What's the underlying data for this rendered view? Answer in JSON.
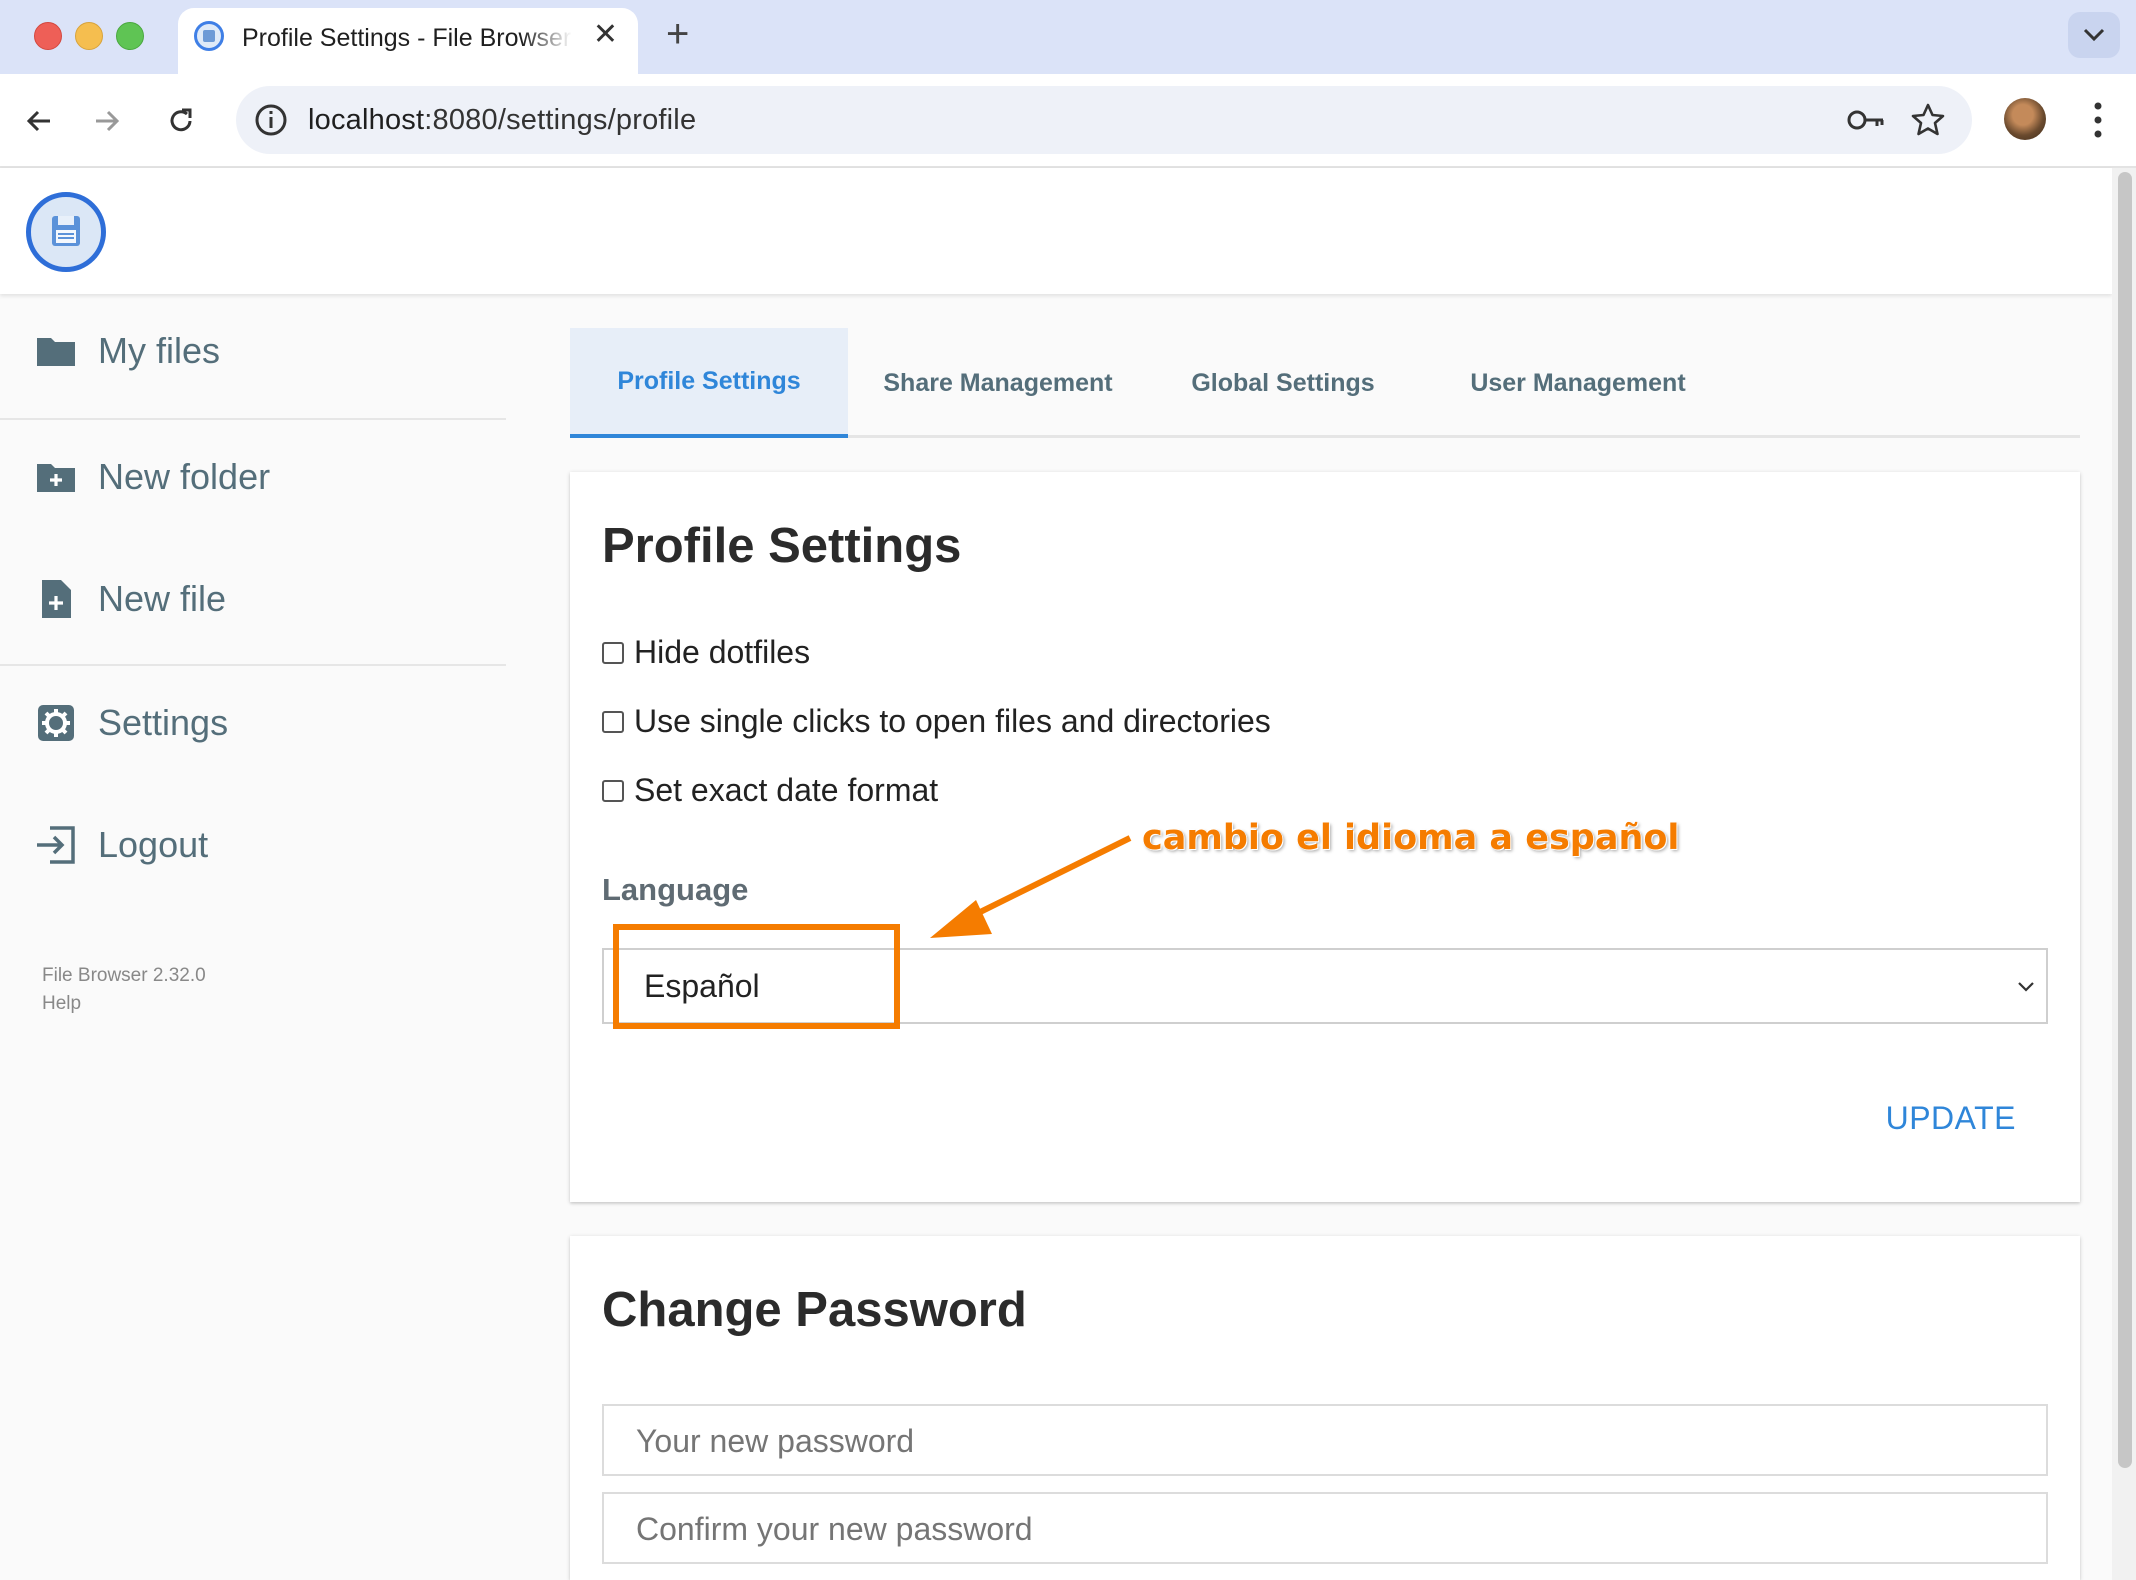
{
  "browser": {
    "tab_title": "Profile Settings - File Browser",
    "url_host": "localhost",
    "url_rest": ":8080/settings/profile"
  },
  "sidebar": {
    "items": [
      {
        "label": "My files",
        "icon": "folder-icon"
      },
      {
        "label": "New folder",
        "icon": "folder-plus-icon"
      },
      {
        "label": "New file",
        "icon": "file-plus-icon"
      },
      {
        "label": "Settings",
        "icon": "gear-icon"
      },
      {
        "label": "Logout",
        "icon": "logout-icon"
      }
    ],
    "version": "File Browser 2.32.0",
    "help": "Help"
  },
  "settings_tabs": [
    {
      "label": "Profile Settings",
      "active": true
    },
    {
      "label": "Share Management",
      "active": false
    },
    {
      "label": "Global Settings",
      "active": false
    },
    {
      "label": "User Management",
      "active": false
    }
  ],
  "profile_card": {
    "title": "Profile Settings",
    "checkboxes": [
      {
        "label": "Hide dotfiles",
        "checked": false
      },
      {
        "label": "Use single clicks to open files and directories",
        "checked": false
      },
      {
        "label": "Set exact date format",
        "checked": false
      }
    ],
    "language_label": "Language",
    "language_value": "Español",
    "update_label": "UPDATE"
  },
  "password_card": {
    "title": "Change Password",
    "new_password_placeholder": "Your new password",
    "confirm_password_placeholder": "Confirm your new password"
  },
  "annotation": {
    "text": "cambio el idioma a español",
    "color": "#f57c00"
  },
  "colors": {
    "accent": "#2f86d9",
    "sidebar_text": "#546e7a"
  }
}
